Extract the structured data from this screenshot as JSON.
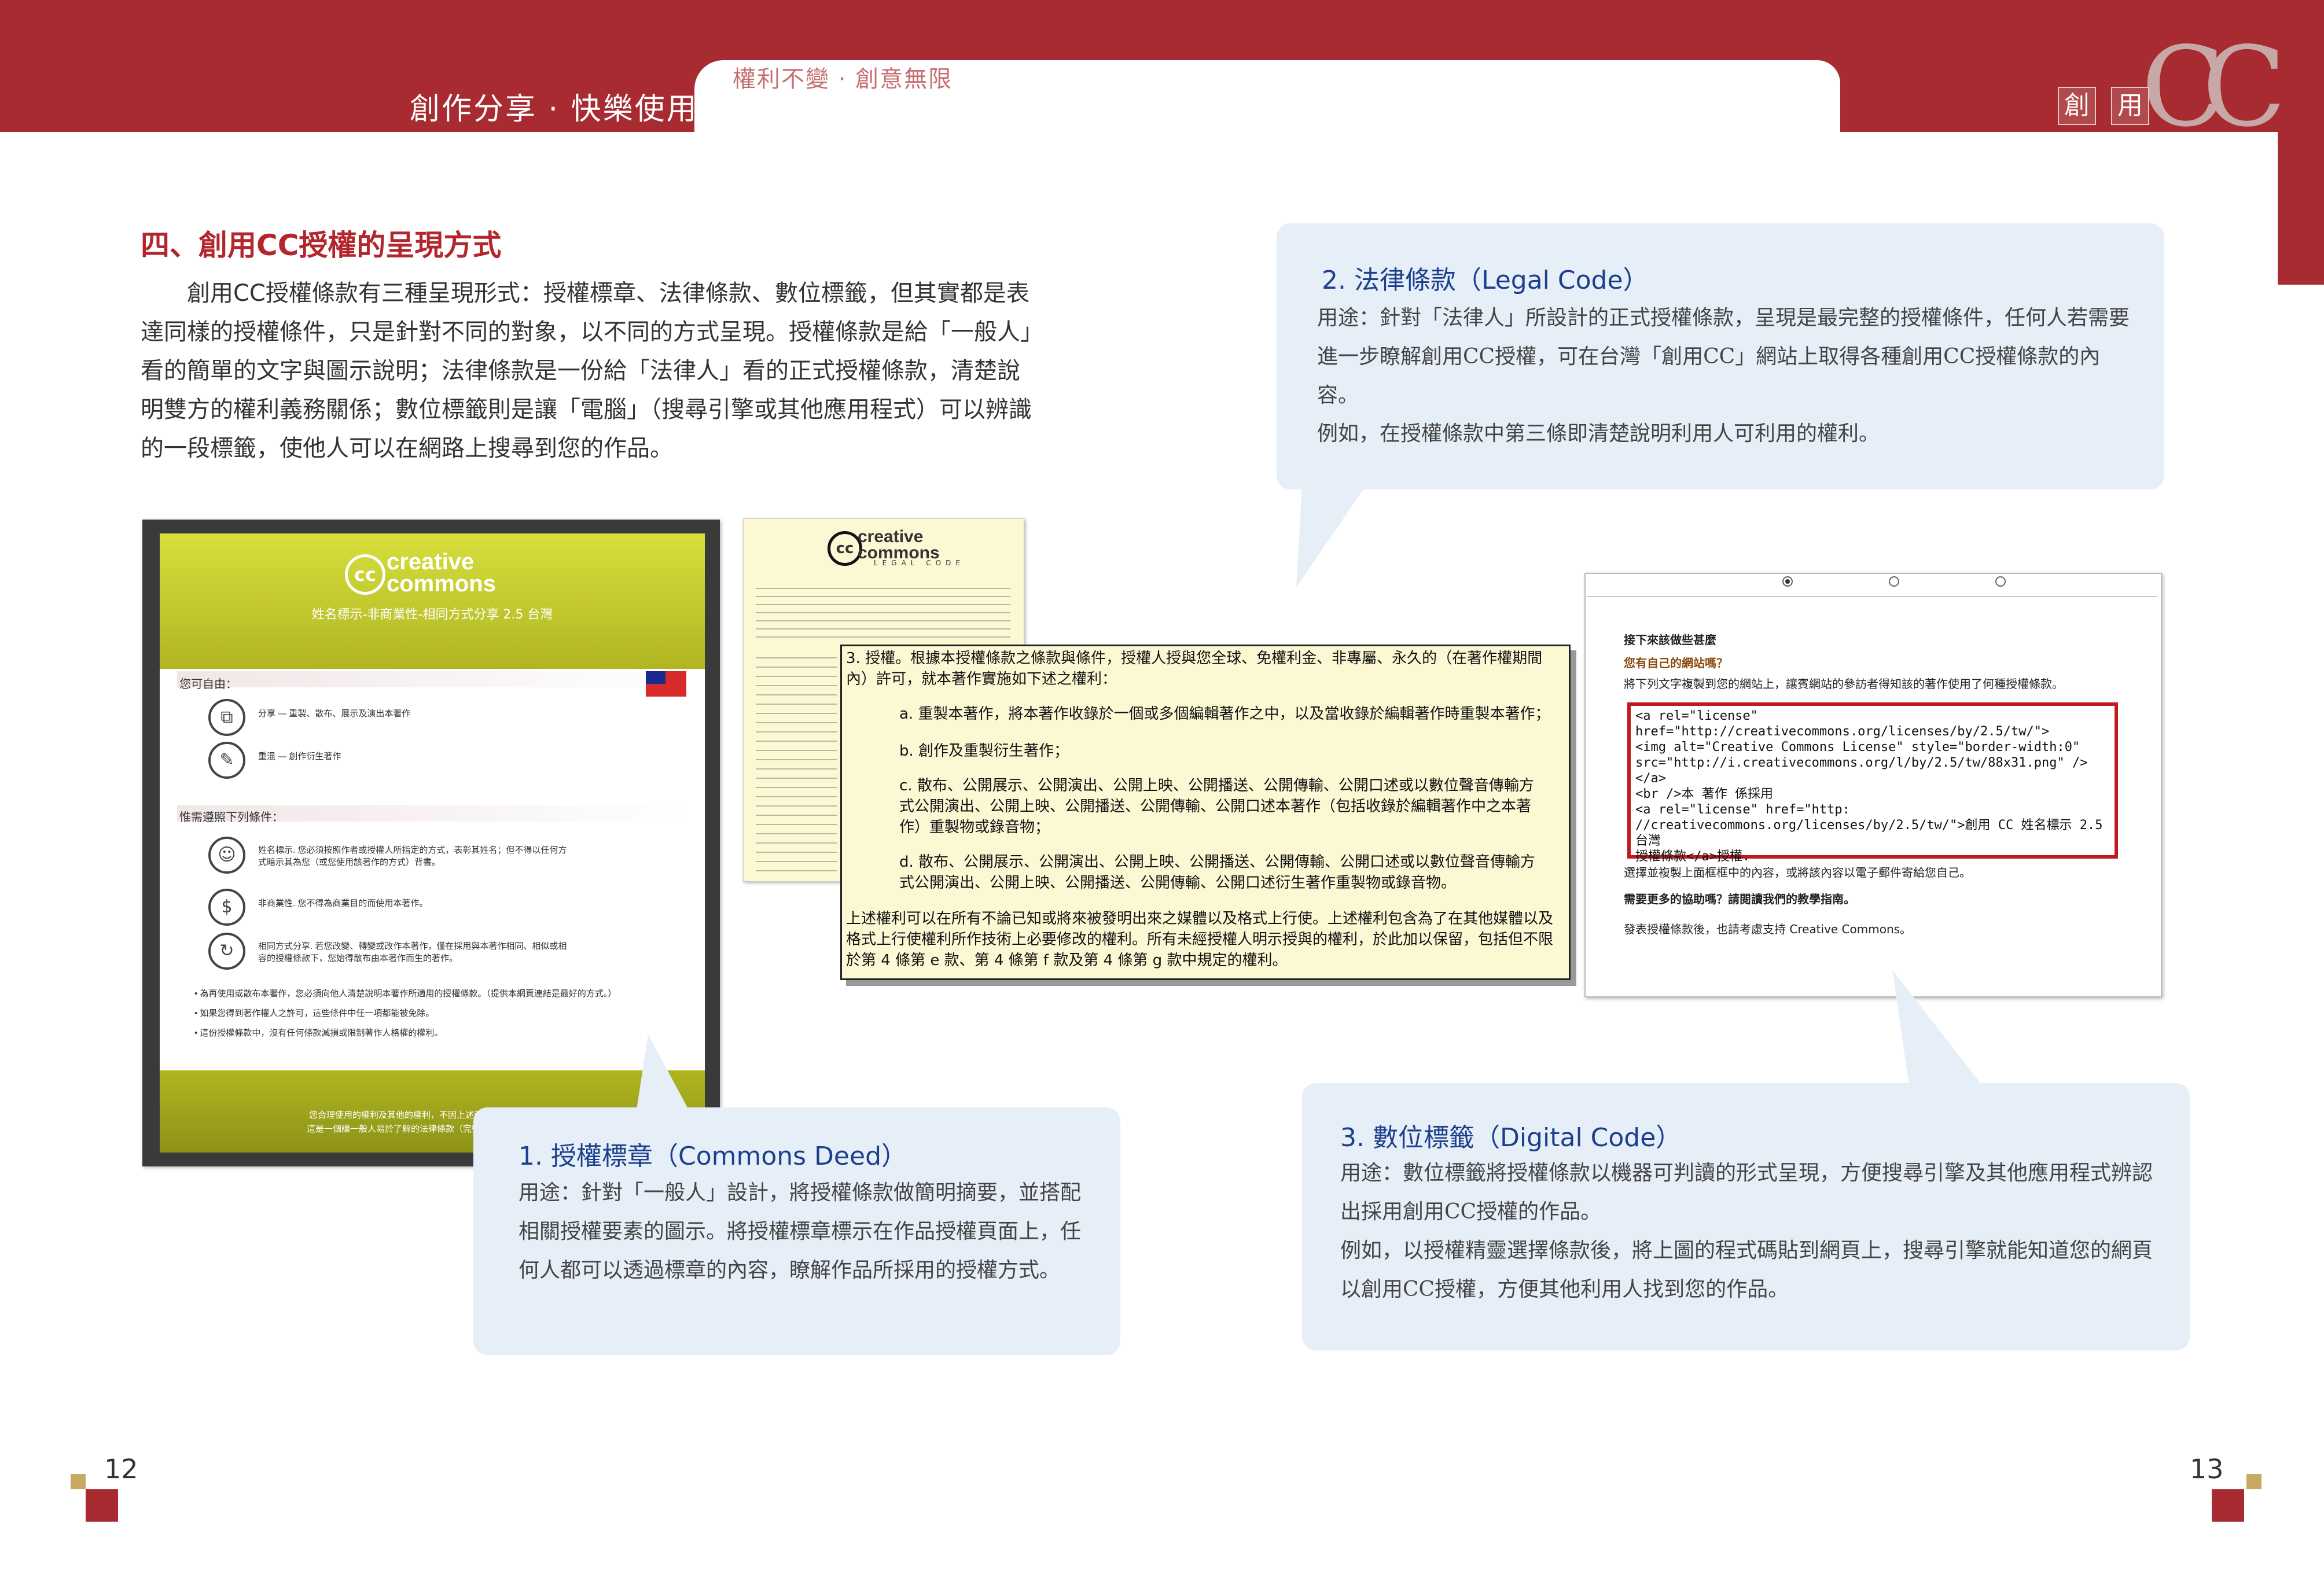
{
  "header": {
    "slogan_left": "創作分享 · 快樂使用",
    "slogan_right": "權利不變 · 創意無限",
    "logo_chars": [
      "創",
      "用"
    ],
    "logo_cc": "CC"
  },
  "section": {
    "title": "四、創用CC授權的呈現方式",
    "intro": "創用CC授權條款有三種呈現形式：授權標章、法律條款、數位標籤，但其實都是表達同樣的授權條件，只是針對不同的對象，以不同的方式呈現。授權條款是給「一般人」看的簡單的文字與圖示說明；法律條款是一份給「法律人」看的正式授權條款，清楚說明雙方的權利義務關係；數位標籤則是讓「電腦」（搜尋引擎或其他應用程式）可以辨識的一段標籤，使他人可以在網路上搜尋到您的作品。"
  },
  "bubbles": {
    "deed": {
      "title": "1. 授權標章（Commons Deed）",
      "text": "用途：針對「一般人」設計，將授權條款做簡明摘要，並搭配相關授權要素的圖示。將授權標章標示在作品授權頁面上，任何人都可以透過標章的內容，瞭解作品所採用的授權方式。"
    },
    "legal": {
      "title": "2. 法律條款（Legal Code）",
      "text1": "用途：針對「法律人」所設計的正式授權條款，呈現是最完整的授權條件，任何人若需要進一步瞭解創用CC授權，可在台灣「創用CC」網站上取得各種創用CC授權條款的內容。",
      "text2": "例如，在授權條款中第三條即清楚說明利用人可利用的權利。"
    },
    "digital": {
      "title": "3. 數位標籤（Digital Code）",
      "text1": "用途：數位標籤將授權條款以機器可判讀的形式呈現，方便搜尋引擎及其他應用程式辨認出採用創用CC授權的作品。",
      "text2": "例如，以授權精靈選擇條款後，將上圖的程式碼貼到網頁上，搜尋引擎就能知道您的網頁以創用CC授權，方便其他利用人找到您的作品。"
    }
  },
  "deed_shot": {
    "logo": "creative commons",
    "subtitle": "姓名標示-非商業性-相同方式分享 2.5 台灣",
    "free_heading": "您可自由：",
    "free_items": [
      "分享 — 重製、散布、展示及演出本著作",
      "重混 — 創作衍生著作"
    ],
    "cond_heading": "惟需遵照下列條件：",
    "cond_items": [
      "姓名標示. 您必須按照作者或授權人所指定的方式，表彰其姓名；但不得以任何方式暗示其為您（或您使用該著作的方式）背書。",
      "非商業性. 您不得為商業目的而使用本著作。",
      "相同方式分享. 若您改變、轉變或改作本著作，僅在採用與本著作相同、相似或相容的授權條款下，您始得散布由本著作而生的著作。"
    ],
    "bullets": [
      "為再使用或散布本著作，您必須向他人清楚說明本著作所適用的授權條款。（提供本網頁連結是最好的方式。）",
      "如果您得到著作權人之許可，這些條件中任一項都能被免除。",
      "這份授權條款中，沒有任何條款減損或限制著作人格權的權利。"
    ],
    "footer": "您合理使用的權利及其他的權利，不因上述而受影響。",
    "footer2": "這是一個讓一般人易於了解的法律條款（完整授權條款）的摘要。"
  },
  "legal_shot": {
    "logo": "creative commons",
    "sublogo": "LEGAL CODE",
    "clause_head": "3. 授權。根據本授權條款之條款與條件，授權人授與您全球、免權利金、非專屬、永久的（在著作權期間內）許可，就本著作實施如下述之權利：",
    "items": [
      "a. 重製本著作，將本著作收錄於一個或多個編輯著作之中，以及當收錄於編輯著作時重製本著作；",
      "b. 創作及重製衍生著作；",
      "c. 散布、公開展示、公開演出、公開上映、公開播送、公開傳輸、公開口述或以數位聲音傳輸方式公開演出、公開上映、公開播送、公開傳輸、公開口述本著作（包括收錄於編輯著作中之本著作）重製物或錄音物；",
      "d. 散布、公開展示、公開演出、公開上映、公開播送、公開傳輸、公開口述或以數位聲音傳輸方式公開演出、公開上映、公開播送、公開傳輸、公開口述衍生著作重製物或錄音物。"
    ],
    "tail": "上述權利可以在所有不論已知或將來被發明出來之媒體以及格式上行使。上述權利包含為了在其他媒體以及格式上行使權利所作技術上必要修改的權利。所有未經授權人明示授與的權利，於此加以保留，包括但不限於第 4 條第 e 款、第 4 條第 f 款及第 4 條第 g 款中規定的權利。"
  },
  "code_shot": {
    "heading": "接下來該做些甚麼",
    "q1": "您有自己的網站嗎？",
    "q1_text": "將下列文字複製到您的網站上，讓賓網站的參訪者得知該的著作使用了何種授權條款。",
    "code_lines": [
      "<a rel=\"license\"",
      "href=\"http://creativecommons.org/licenses/by/2.5/tw/\">",
      "<img alt=\"Creative Commons License\" style=\"border-width:0\"",
      "src=\"http://i.creativecommons.org/l/by/2.5/tw/88x31.png\" />",
      "</a>",
      "<br />本 著作 係採用",
      "<a rel=\"license\" href=\"http:",
      "//creativecommons.org/licenses/by/2.5/tw/\">創用 CC 姓名標示 2.5 台灣",
      "授權條款</a>授權."
    ],
    "after_code": "選擇並複製上面框框中的內容，或將該內容以電子郵件寄給您自己。",
    "q2": "需要更多的協助嗎？請閱讀我們的教學指南。",
    "q2_text": "發表授權條款後，也請考慮支持 Creative Commons。"
  },
  "pages": {
    "left": "12",
    "right": "13"
  },
  "colors": {
    "brand_red": "#a72b30",
    "bubble_bg": "#e6eef8",
    "title_blue": "#1c3f8c"
  }
}
